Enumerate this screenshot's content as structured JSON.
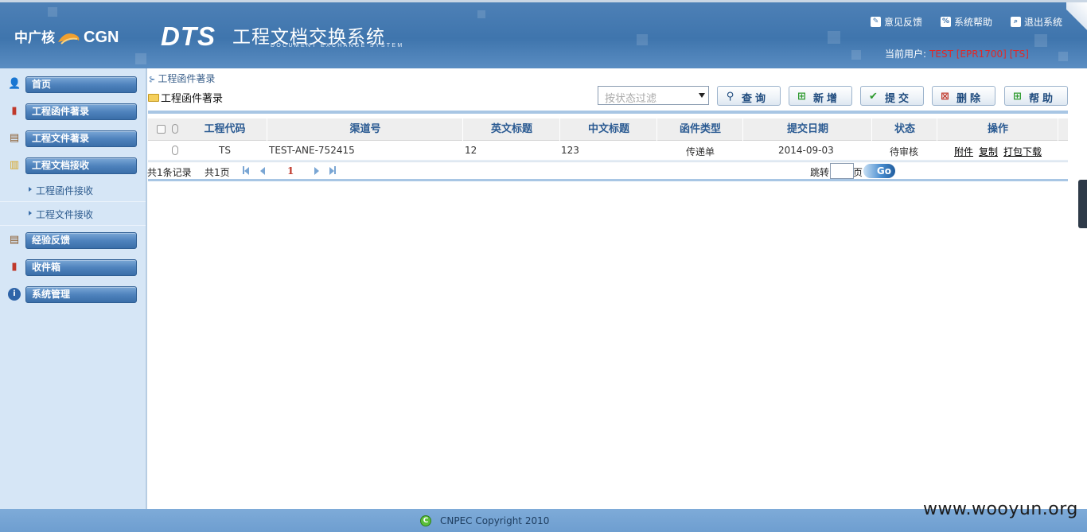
{
  "header": {
    "logo_cgn_text": "中广核",
    "logo_cgn_latin": "CGN",
    "logo_dts": "DTS",
    "system_title": "工程文档交换系统",
    "system_subtitle": "DOCUMENT EXCHANGE SYSTEM",
    "links": {
      "feedback": "意见反馈",
      "help": "系统帮助",
      "logout": "退出系统"
    },
    "current_user_label": "当前用户:",
    "current_user_value": "TEST [EPR1700] [TS]"
  },
  "sidebar": {
    "items": [
      {
        "label": "首页",
        "icon": "user-icon"
      },
      {
        "label": "工程函件著录",
        "icon": "book-icon"
      },
      {
        "label": "工程文件著录",
        "icon": "clipboard-icon"
      },
      {
        "label": "工程文档接收",
        "icon": "document-icon"
      },
      {
        "label": "经验反馈",
        "icon": "clipboard-icon"
      },
      {
        "label": "收件箱",
        "icon": "book-icon"
      },
      {
        "label": "系统管理",
        "icon": "info-icon"
      }
    ],
    "sub_items": [
      {
        "label": "工程函件接收"
      },
      {
        "label": "工程文件接收"
      }
    ]
  },
  "main": {
    "breadcrumb": "工程函件著录",
    "folder_title": "工程函件著录",
    "status_filter_placeholder": "按状态过滤",
    "buttons": {
      "query": "查询",
      "add": "新增",
      "submit": "提交",
      "delete": "删除",
      "help": "帮助"
    },
    "table": {
      "columns": [
        "工程代码",
        "渠道号",
        "英文标题",
        "中文标题",
        "函件类型",
        "提交日期",
        "状态",
        "操作"
      ],
      "rows": [
        {
          "project_code": "TS",
          "channel_no": "TEST-ANE-752415",
          "en_title": "12",
          "cn_title": "123",
          "letter_type": "传递单",
          "submit_date": "2014-09-03",
          "status": "待审核",
          "actions": [
            "附件",
            "复制",
            "打包下载"
          ]
        }
      ]
    },
    "pager": {
      "total_records": "共1条记录",
      "total_pages": "共1页",
      "current_page": "1",
      "jump_label": "跳转",
      "page_unit": "页",
      "go_label": "Go"
    }
  },
  "footer": {
    "copyright": "CNPEC Copyright 2010",
    "watermark": "www.wooyun.org"
  },
  "colors": {
    "header_blue": "#4d80b6",
    "nav_bar_blue": "#4f83bd",
    "sidebar_bg": "#d6e6f6",
    "user_red": "#e02828",
    "column_header_text": "#2a5a92",
    "footer_blue": "#7eabd8"
  }
}
